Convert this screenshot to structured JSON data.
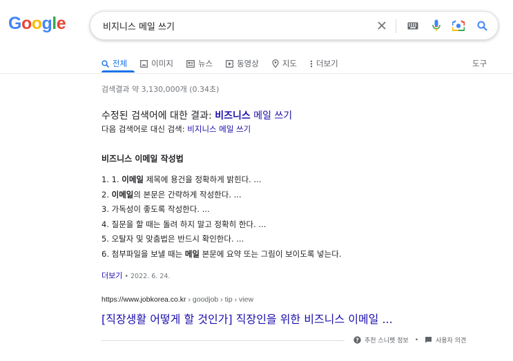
{
  "logo": {
    "letters": [
      "G",
      "o",
      "o",
      "g",
      "l",
      "e"
    ],
    "colors": [
      "#4285f4",
      "#ea4335",
      "#fbbc05",
      "#4285f4",
      "#34a853",
      "#ea4335"
    ]
  },
  "search": {
    "query": "비지니스 메일 쓰기",
    "icons": [
      "close-icon",
      "keyboard-icon",
      "microphone-icon",
      "camera-icon",
      "search-icon"
    ]
  },
  "tabs": [
    {
      "label": "전체",
      "icon": "search-icon",
      "active": true
    },
    {
      "label": "이미지",
      "icon": "image-icon"
    },
    {
      "label": "뉴스",
      "icon": "news-icon"
    },
    {
      "label": "동영상",
      "icon": "video-icon"
    },
    {
      "label": "지도",
      "icon": "map-pin-icon"
    },
    {
      "label": "더보기",
      "icon": "more-vert-icon"
    }
  ],
  "tools_label": "도구",
  "result_stats": "검색결과 약 3,130,000개 (0.34초)",
  "spelling": {
    "prefix": "수정된 검색어에 대한 결과: ",
    "bold": "비즈니스",
    "rest": " 메일 쓰기",
    "instead_prefix": "다음 검색어로 대신 검색: ",
    "instead_link": "비지니스 메일 쓰기"
  },
  "featured": {
    "title": "비즈니스 이메일 작성법",
    "steps": [
      {
        "pre": "1. 1. ",
        "bold": "이메일",
        "post": " 제목에 용건을 정확하게 밝힌다. ..."
      },
      {
        "pre": "2. ",
        "bold": "이메일",
        "post": "의 본문은 간략하게 작성한다. ..."
      },
      {
        "pre": "3. 가독성이 좋도록 작성한다. ...",
        "bold": "",
        "post": ""
      },
      {
        "pre": "4. 질문을 할 때는 돌려 하지 말고 정확히 한다. ...",
        "bold": "",
        "post": ""
      },
      {
        "pre": "5. 오탈자 및 맞춤법은 반드시 확인한다. ...",
        "bold": "",
        "post": ""
      },
      {
        "pre": "6. 첨부파일을 보낼 때는 ",
        "bold": "메일",
        "post": " 본문에 요약 또는 그림이 보이도록 넣는다."
      }
    ],
    "more_label": "더보기",
    "date": " • 2022. 6. 24."
  },
  "result": {
    "url_host": "https://www.jobkorea.co.kr",
    "url_path": " › goodjob › tip › view",
    "title": "[직장생활 어떻게 할 것인가] 직장인을 위한 비즈니스 이메일 ..."
  },
  "footer": {
    "about": "추천 스니펫 정보",
    "separator": "•",
    "feedback": "사용자 의견"
  }
}
